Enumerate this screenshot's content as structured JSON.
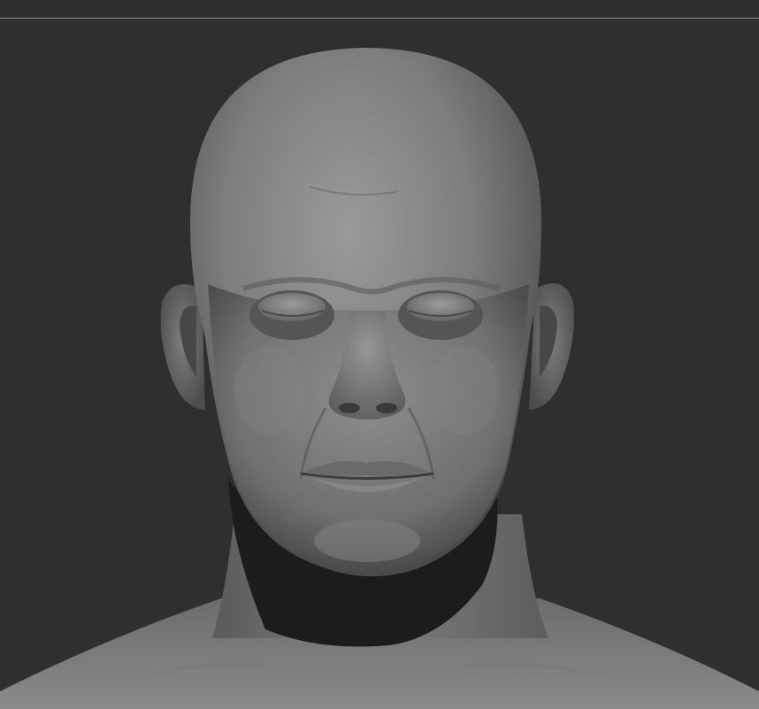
{
  "app": {
    "type": "3d-sculpt-viewport"
  },
  "viewport": {
    "background_color": "#2f2f2f",
    "divider_color": "#8a8a8a",
    "model": {
      "subject": "male-head-bust-sculpt",
      "material_color": "#8c8c8c",
      "shadow_color": "#1c1c1c"
    }
  }
}
